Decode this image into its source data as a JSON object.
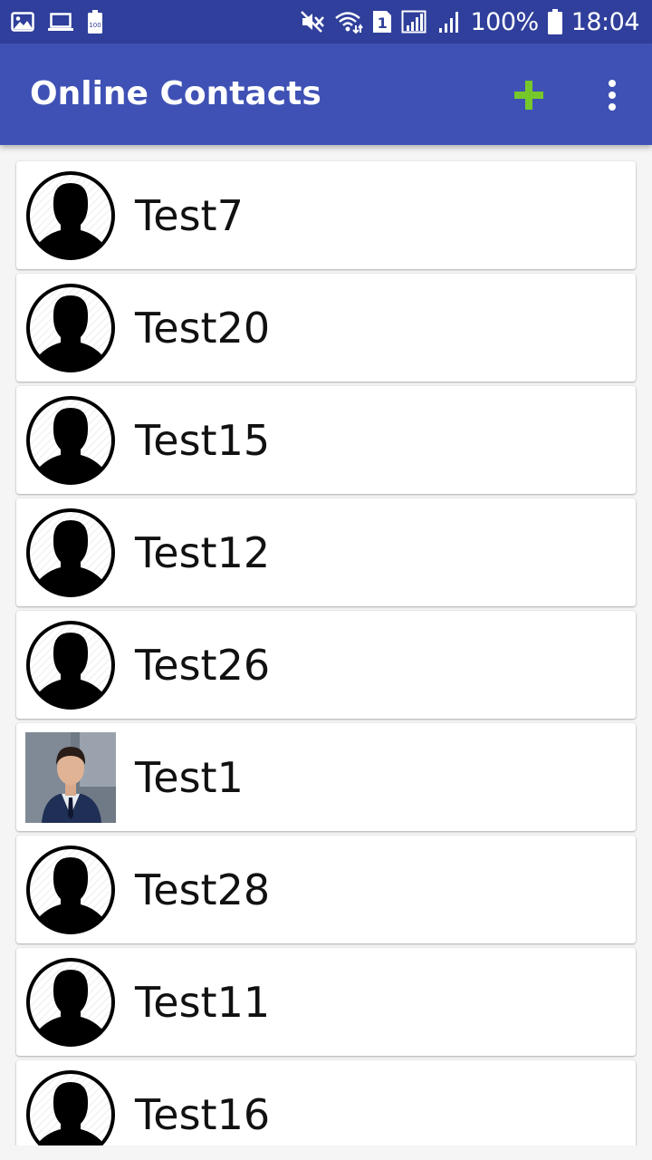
{
  "status_bar": {
    "battery_percent": "100%",
    "time": "18:04",
    "sim_slot": "1",
    "left_icons": [
      "image-icon",
      "laptop-icon",
      "battery-saver-icon"
    ],
    "right_icons": [
      "mute-icon",
      "wifi-icon",
      "sim-icon",
      "signal-icon",
      "signal-icon",
      "battery-icon"
    ]
  },
  "app_bar": {
    "title": "Online Contacts",
    "add_icon": "plus-icon",
    "add_color": "#76c82a",
    "menu_icon": "more-vert-icon",
    "background": "#3f51b5"
  },
  "contacts": [
    {
      "name": "Test7",
      "avatar": "default-avatar"
    },
    {
      "name": "Test20",
      "avatar": "default-avatar"
    },
    {
      "name": "Test15",
      "avatar": "default-avatar"
    },
    {
      "name": "Test12",
      "avatar": "default-avatar"
    },
    {
      "name": "Test26",
      "avatar": "default-avatar"
    },
    {
      "name": "Test1",
      "avatar": "photo"
    },
    {
      "name": "Test28",
      "avatar": "default-avatar"
    },
    {
      "name": "Test11",
      "avatar": "default-avatar"
    },
    {
      "name": "Test16",
      "avatar": "default-avatar"
    }
  ]
}
